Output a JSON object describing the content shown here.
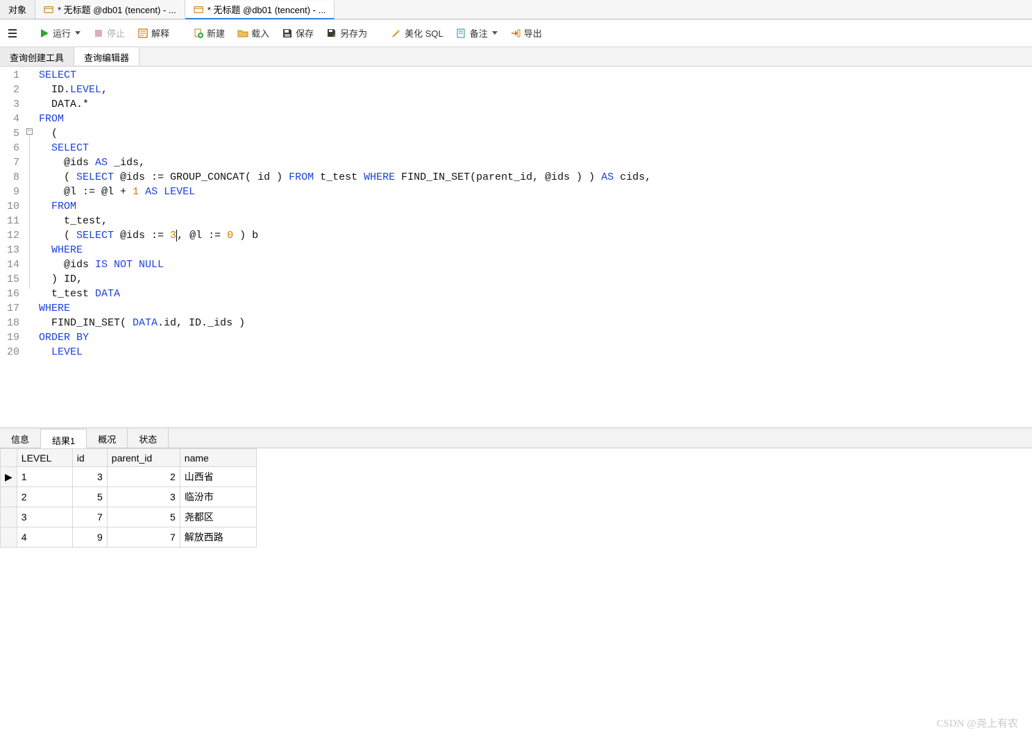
{
  "tabstrip": {
    "object_tab": "对象",
    "tabs": [
      {
        "label": "* 无标题 @db01 (tencent) - ...",
        "active": false
      },
      {
        "label": "* 无标题 @db01 (tencent) - ...",
        "active": true
      }
    ]
  },
  "toolbar": {
    "run": "运行",
    "stop": "停止",
    "explain": "解释",
    "new": "新建",
    "load": "载入",
    "save": "保存",
    "saveas": "另存为",
    "beautify": "美化 SQL",
    "note": "备注",
    "export": "导出"
  },
  "subtabs": {
    "builder": "查询创建工具",
    "editor": "查询编辑器"
  },
  "sql": {
    "lines": [
      [
        {
          "t": "SELECT",
          "c": "kw"
        }
      ],
      [
        {
          "t": "  ID",
          "c": "txt"
        },
        {
          "t": ".",
          "c": "txt"
        },
        {
          "t": "LEVEL",
          "c": "kw"
        },
        {
          "t": ",",
          "c": "txt"
        }
      ],
      [
        {
          "t": "  DATA",
          "c": "txt"
        },
        {
          "t": ".*",
          "c": "txt"
        }
      ],
      [
        {
          "t": "FROM",
          "c": "kw"
        }
      ],
      [
        {
          "t": "  (",
          "c": "txt"
        }
      ],
      [
        {
          "t": "  ",
          "c": "txt"
        },
        {
          "t": "SELECT",
          "c": "kw"
        }
      ],
      [
        {
          "t": "    @ids ",
          "c": "txt"
        },
        {
          "t": "AS",
          "c": "kw"
        },
        {
          "t": " _ids,",
          "c": "txt"
        }
      ],
      [
        {
          "t": "    ( ",
          "c": "txt"
        },
        {
          "t": "SELECT",
          "c": "kw"
        },
        {
          "t": " @ids := GROUP_CONCAT( id ) ",
          "c": "txt"
        },
        {
          "t": "FROM",
          "c": "kw"
        },
        {
          "t": " t_test ",
          "c": "txt"
        },
        {
          "t": "WHERE",
          "c": "kw"
        },
        {
          "t": " FIND_IN_SET(parent_id, @ids ) ) ",
          "c": "txt"
        },
        {
          "t": "AS",
          "c": "kw"
        },
        {
          "t": " cids,",
          "c": "txt"
        }
      ],
      [
        {
          "t": "    @l := @l + ",
          "c": "txt"
        },
        {
          "t": "1",
          "c": "num"
        },
        {
          "t": " ",
          "c": "txt"
        },
        {
          "t": "AS",
          "c": "kw"
        },
        {
          "t": " ",
          "c": "txt"
        },
        {
          "t": "LEVEL",
          "c": "kw"
        }
      ],
      [
        {
          "t": "  ",
          "c": "txt"
        },
        {
          "t": "FROM",
          "c": "kw"
        }
      ],
      [
        {
          "t": "    t_test,",
          "c": "txt"
        }
      ],
      [
        {
          "t": "    ( ",
          "c": "txt"
        },
        {
          "t": "SELECT",
          "c": "kw"
        },
        {
          "t": " @ids := ",
          "c": "txt"
        },
        {
          "t": "3",
          "c": "num"
        },
        {
          "t": "",
          "c": "cursor"
        },
        {
          "t": ", @l := ",
          "c": "txt"
        },
        {
          "t": "0",
          "c": "num"
        },
        {
          "t": " ) b",
          "c": "txt"
        }
      ],
      [
        {
          "t": "  ",
          "c": "txt"
        },
        {
          "t": "WHERE",
          "c": "kw"
        }
      ],
      [
        {
          "t": "    @ids ",
          "c": "txt"
        },
        {
          "t": "IS NOT NULL",
          "c": "kw"
        }
      ],
      [
        {
          "t": "  ) ID,",
          "c": "txt"
        }
      ],
      [
        {
          "t": "  t_test ",
          "c": "txt"
        },
        {
          "t": "DATA",
          "c": "kw"
        }
      ],
      [
        {
          "t": "WHERE",
          "c": "kw"
        }
      ],
      [
        {
          "t": "  FIND_IN_SET( ",
          "c": "txt"
        },
        {
          "t": "DATA",
          "c": "kw"
        },
        {
          "t": ".id, ID._ids )",
          "c": "txt"
        }
      ],
      [
        {
          "t": "ORDER BY",
          "c": "kw"
        }
      ],
      [
        {
          "t": "  ",
          "c": "txt"
        },
        {
          "t": "LEVEL",
          "c": "kw"
        }
      ]
    ],
    "fold_box_line": 5
  },
  "result_tabs": {
    "info": "信息",
    "result1": "结果1",
    "profile": "概况",
    "status": "状态"
  },
  "grid": {
    "columns": [
      "LEVEL",
      "id",
      "parent_id",
      "name"
    ],
    "rows": [
      {
        "ptr": true,
        "LEVEL": "1",
        "id": "3",
        "parent_id": "2",
        "name": "山西省"
      },
      {
        "ptr": false,
        "LEVEL": "2",
        "id": "5",
        "parent_id": "3",
        "name": "临汾市"
      },
      {
        "ptr": false,
        "LEVEL": "3",
        "id": "7",
        "parent_id": "5",
        "name": "尧都区"
      },
      {
        "ptr": false,
        "LEVEL": "4",
        "id": "9",
        "parent_id": "7",
        "name": "解放西路"
      }
    ]
  },
  "watermark": "CSDN @尧上有农"
}
